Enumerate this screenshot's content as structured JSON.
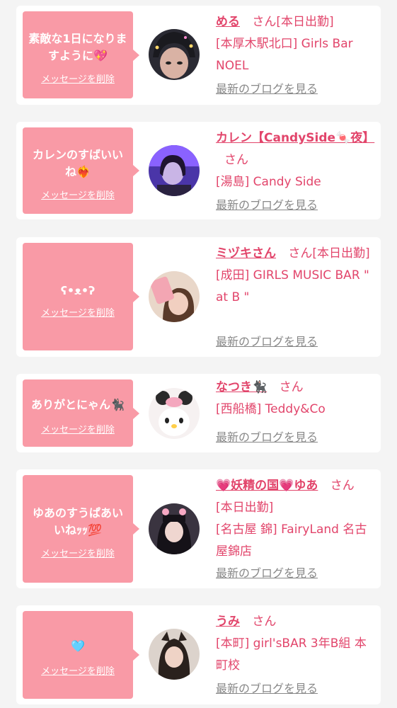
{
  "delete_label": "メッセージを削除",
  "san_label": "さん",
  "blog_label": "最新のブログを見る",
  "colors": {
    "bubble": "#f99aa6",
    "name": "#e2456b",
    "link_gray": "#888888",
    "background": "#f4f4f4"
  },
  "cards": [
    {
      "message": "素敵な1日になりますように💖",
      "name": "める",
      "status": "[本日出勤]",
      "shop": "[本厚木駅北口] Girls Bar NOEL",
      "avatar_icon": "profile-photo"
    },
    {
      "message": "カレンのすばいいね❤️‍🔥",
      "name": "カレン【CandySide🍬夜】",
      "status": "",
      "shop": "[湯島] Candy Side",
      "avatar_icon": "profile-photo"
    },
    {
      "message": "ʕ•ᴥ•ʔ",
      "name": "ミヅキさん",
      "status": "[本日出勤]",
      "shop": "[成田] GIRLS MUSIC BAR \" at B \"",
      "avatar_icon": "profile-photo"
    },
    {
      "message": "ありがとにゃん🐈‍⬛",
      "name": "なつき🐈‍⬛",
      "status": "",
      "shop": "[西船橋] Teddy&Co",
      "avatar_icon": "profile-photo"
    },
    {
      "message": "ゆあのすうぱあいいねｯｯ💯",
      "name": "💗妖精の国💗ゆあ",
      "status": "[本日出勤]",
      "shop": "[名古屋 錦] FairyLand 名古屋錦店",
      "avatar_icon": "profile-photo"
    },
    {
      "message": "🩵",
      "name": "うみ",
      "status": "",
      "shop": "[本町] girl'sBAR 3年B組 本町校",
      "avatar_icon": "profile-photo"
    }
  ]
}
